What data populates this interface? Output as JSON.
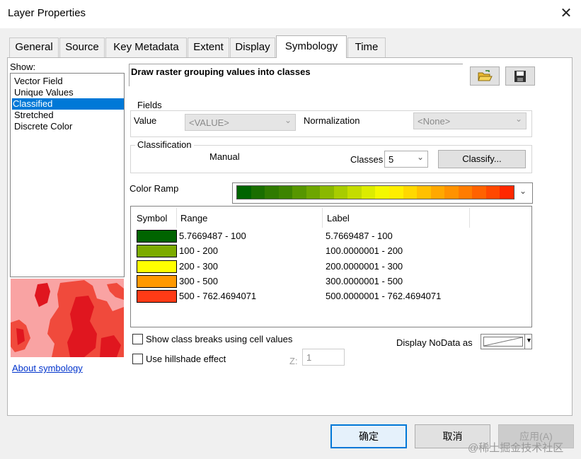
{
  "window": {
    "title": "Layer Properties",
    "close_glyph": "✕"
  },
  "tabs": [
    {
      "label": "General"
    },
    {
      "label": "Source"
    },
    {
      "label": "Key Metadata"
    },
    {
      "label": "Extent"
    },
    {
      "label": "Display"
    },
    {
      "label": "Symbology",
      "active": true
    },
    {
      "label": "Time"
    }
  ],
  "show": {
    "label": "Show:",
    "items": [
      "Vector Field",
      "Unique Values",
      "Classified",
      "Stretched",
      "Discrete Color"
    ],
    "selected": "Classified"
  },
  "about_link": "About symbology",
  "description": "Draw raster grouping values into classes",
  "toolbar": {
    "open_icon": "folder-open-icon",
    "save_icon": "save-disk-icon"
  },
  "fields": {
    "title": "Fields",
    "value_label": "Value",
    "value": "<VALUE>",
    "normalization_label": "Normalization",
    "normalization": "<None>"
  },
  "classification": {
    "title": "Classification",
    "method": "Manual",
    "classes_label": "Classes",
    "classes": "5",
    "classify_button": "Classify..."
  },
  "color_ramp": {
    "label": "Color Ramp",
    "colors": [
      "#006400",
      "#1a6e00",
      "#2f7a00",
      "#3d8400",
      "#569600",
      "#6da600",
      "#8ab800",
      "#a8cc00",
      "#c4dc00",
      "#dcec00",
      "#f4f800",
      "#ffee00",
      "#ffd800",
      "#ffc000",
      "#ffa800",
      "#ff9200",
      "#ff7c00",
      "#ff6200",
      "#ff4800",
      "#ff2800"
    ]
  },
  "table": {
    "headers": {
      "symbol": "Symbol",
      "range": "Range",
      "label": "Label"
    },
    "rows": [
      {
        "color": "#006400",
        "range": "5.7669487 - 100",
        "label": "5.7669487 - 100"
      },
      {
        "color": "#7cab00",
        "range": "100 - 200",
        "label": "100.0000001 - 200"
      },
      {
        "color": "#ffff00",
        "range": "200 - 300",
        "label": "200.0000001 - 300"
      },
      {
        "color": "#ff9900",
        "range": "300 - 500",
        "label": "300.0000001 - 500"
      },
      {
        "color": "#ff3b16",
        "range": "500 - 762.4694071",
        "label": "500.0000001 - 762.4694071"
      }
    ]
  },
  "options": {
    "show_class_breaks": "Show class breaks using cell values",
    "use_hillshade": "Use hillshade effect",
    "z_label": "Z:",
    "z_value": "1",
    "nodata_label": "Display NoData as"
  },
  "buttons": {
    "ok": "确定",
    "cancel": "取消",
    "apply": "应用(A)"
  },
  "watermark": "@稀土掘金技术社区",
  "colors": {
    "selection": "#0078d7",
    "preview_light": "#f9a3a3",
    "preview_mid": "#f04a3c",
    "preview_dark": "#e0161f"
  }
}
